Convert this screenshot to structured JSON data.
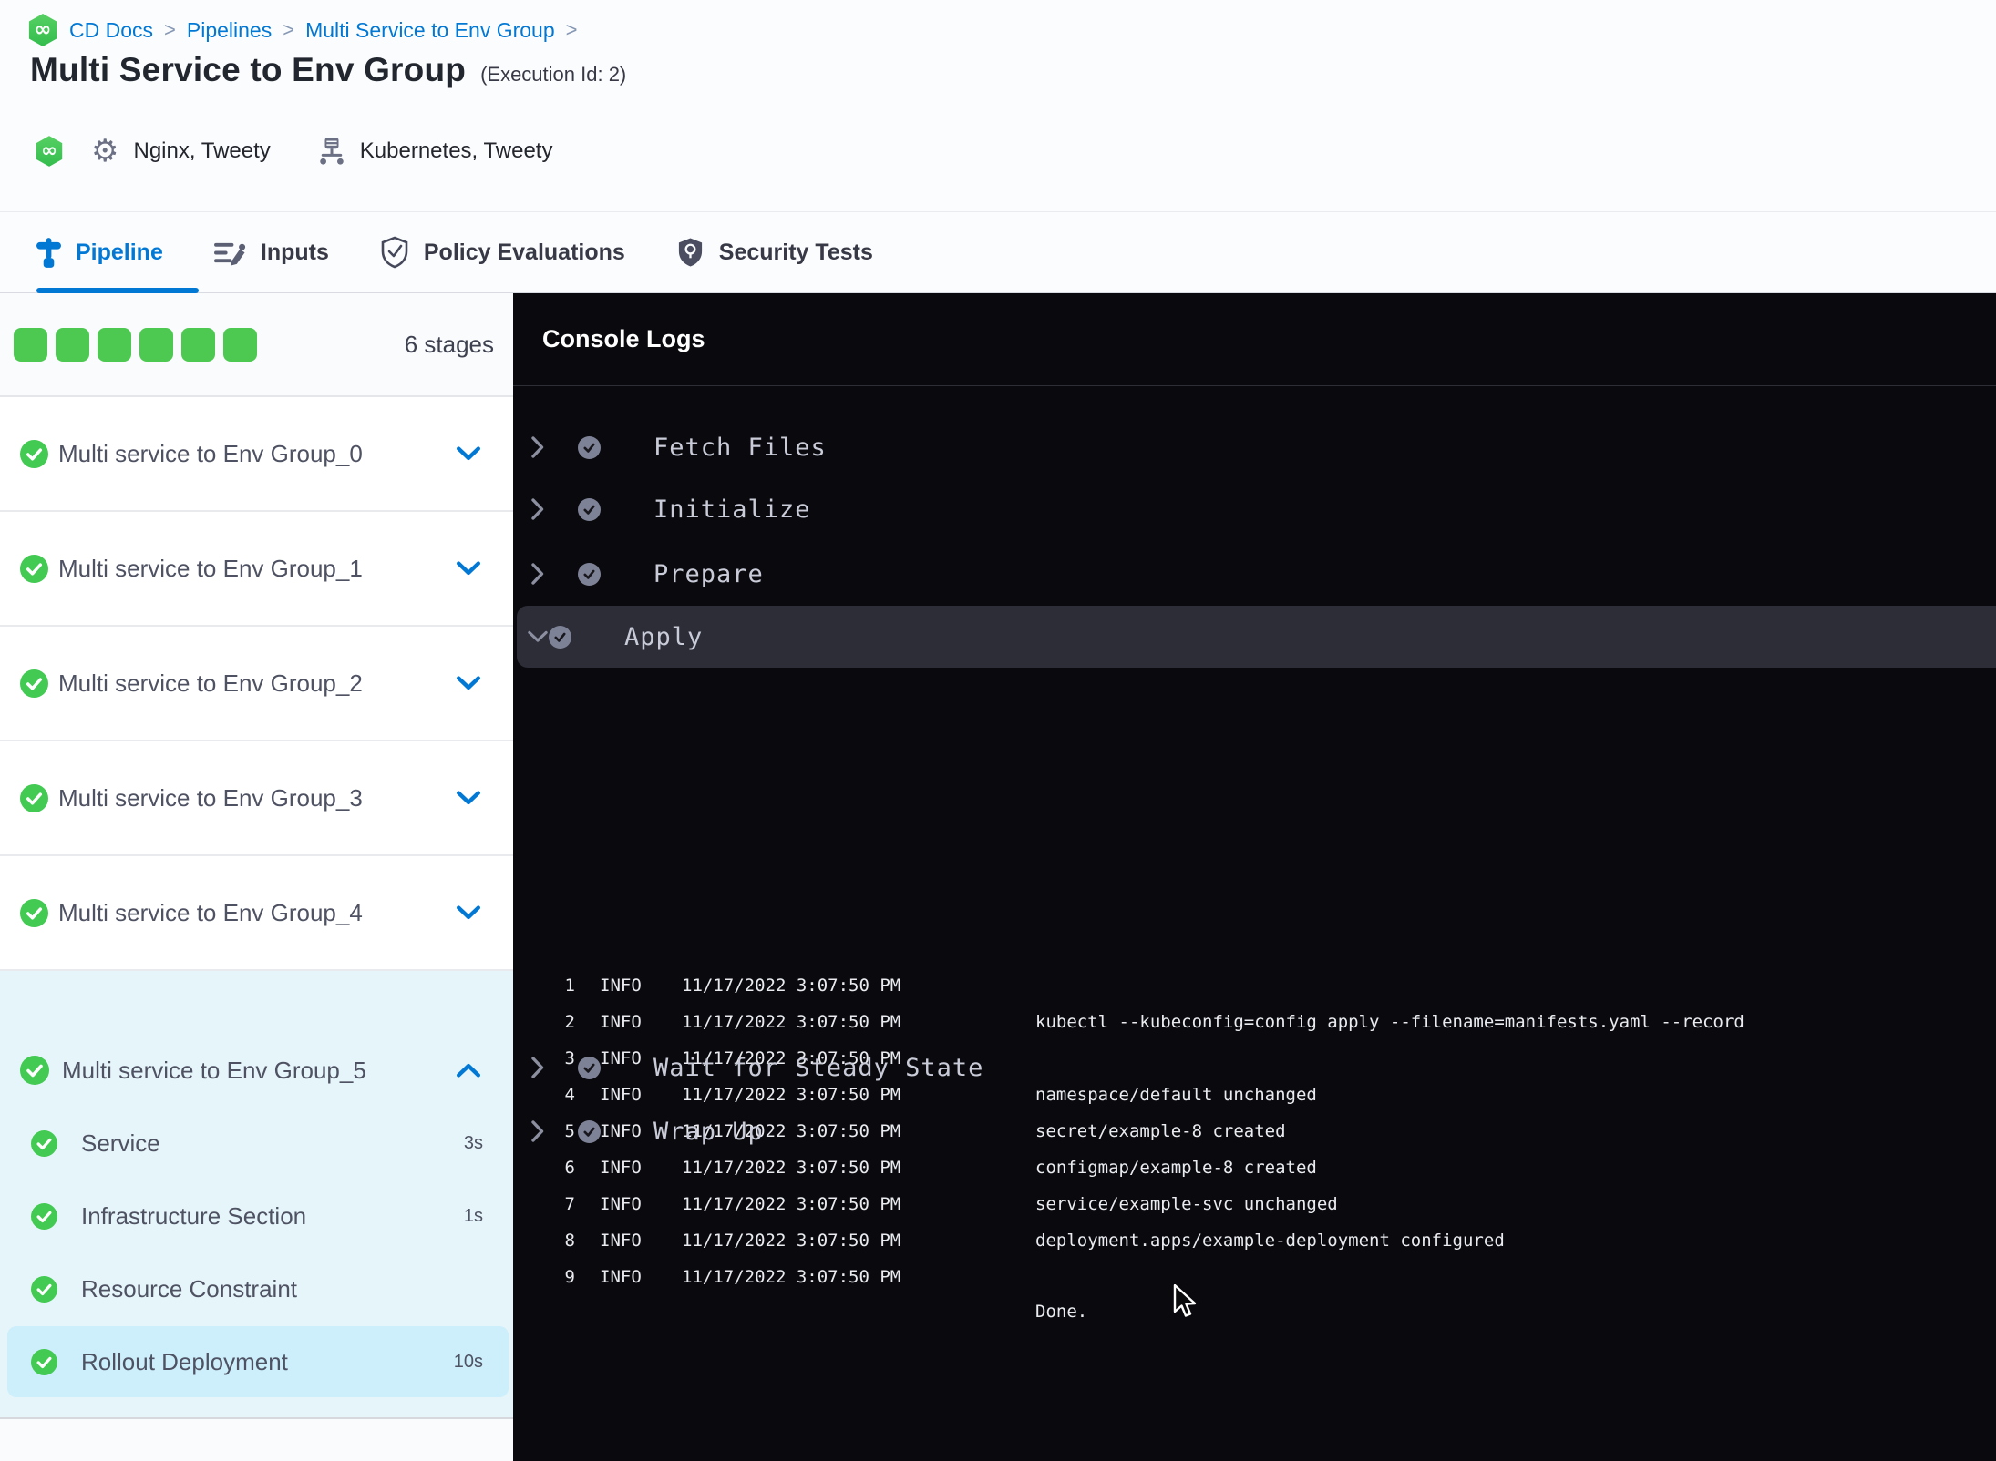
{
  "colors": {
    "accent_blue": "#0278d5",
    "success_green": "#4dc952",
    "console_bg": "#0a0a0e",
    "selected_row": "#cdeefb"
  },
  "breadcrumb": {
    "separator": ">",
    "items": [
      {
        "label": "CD Docs"
      },
      {
        "label": "Pipelines"
      },
      {
        "label": "Multi Service to Env Group"
      }
    ]
  },
  "header": {
    "title": "Multi Service to Env Group",
    "execution_id": "(Execution Id: 2)",
    "services": "Nginx, Tweety",
    "environments": "Kubernetes, Tweety"
  },
  "tabs": [
    {
      "label": "Pipeline"
    },
    {
      "label": "Inputs"
    },
    {
      "label": "Policy Evaluations"
    },
    {
      "label": "Security Tests"
    }
  ],
  "sidebar": {
    "stage_count": "6 stages",
    "collapsed_stages": [
      {
        "label": "Multi service to Env Group_0"
      },
      {
        "label": "Multi service to Env Group_1"
      },
      {
        "label": "Multi service to Env Group_2"
      },
      {
        "label": "Multi service to Env Group_3"
      },
      {
        "label": "Multi service to Env Group_4"
      }
    ],
    "expanded_stage": {
      "label": "Multi service to Env Group_5",
      "steps": [
        {
          "label": "Service",
          "duration": "3s"
        },
        {
          "label": "Infrastructure Section",
          "duration": "1s"
        },
        {
          "label": "Resource Constraint",
          "duration": ""
        },
        {
          "label": "Rollout Deployment",
          "duration": "10s"
        }
      ]
    }
  },
  "console": {
    "title": "Console Logs",
    "collapsed_steps_before": [
      {
        "label": "Fetch Files"
      },
      {
        "label": "Initialize"
      },
      {
        "label": "Prepare"
      }
    ],
    "expanded_step": {
      "label": "Apply",
      "logs": [
        {
          "num": "1",
          "level": "INFO",
          "time": "11/17/2022 3:07:50 PM",
          "msg": ""
        },
        {
          "num": "2",
          "level": "INFO",
          "time": "11/17/2022 3:07:50 PM",
          "msg": "kubectl --kubeconfig=config apply --filename=manifests.yaml --record"
        },
        {
          "num": "3",
          "level": "INFO",
          "time": "11/17/2022 3:07:50 PM",
          "msg": ""
        },
        {
          "num": "4",
          "level": "INFO",
          "time": "11/17/2022 3:07:50 PM",
          "msg": "namespace/default unchanged"
        },
        {
          "num": "5",
          "level": "INFO",
          "time": "11/17/2022 3:07:50 PM",
          "msg": "secret/example-8 created"
        },
        {
          "num": "6",
          "level": "INFO",
          "time": "11/17/2022 3:07:50 PM",
          "msg": "configmap/example-8 created"
        },
        {
          "num": "7",
          "level": "INFO",
          "time": "11/17/2022 3:07:50 PM",
          "msg": "service/example-svc unchanged"
        },
        {
          "num": "8",
          "level": "INFO",
          "time": "11/17/2022 3:07:50 PM",
          "msg": "deployment.apps/example-deployment configured"
        },
        {
          "num": "9",
          "level": "INFO",
          "time": "11/17/2022 3:07:50 PM",
          "msg": ""
        }
      ],
      "done_msg": "Done."
    },
    "collapsed_steps_after": [
      {
        "label": "Wait for Steady State"
      },
      {
        "label": "Wrap Up"
      }
    ]
  }
}
